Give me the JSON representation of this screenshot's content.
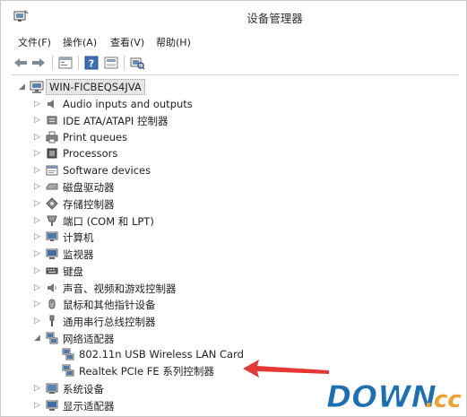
{
  "window": {
    "title": "设备管理器"
  },
  "menubar": {
    "items": [
      "文件(F)",
      "操作(A)",
      "查看(V)",
      "帮助(H)"
    ]
  },
  "toolbar": {
    "buttons": [
      "back-icon",
      "forward-icon",
      "properties-icon",
      "help-icon",
      "view-icon",
      "scan-hardware-icon"
    ]
  },
  "tree": {
    "root": "WIN-FICBEQS4JVA",
    "categories": [
      {
        "label": "Audio inputs and outputs",
        "icon": "speaker-icon",
        "expanded": false
      },
      {
        "label": "IDE ATA/ATAPI 控制器",
        "icon": "ide-controller-icon",
        "expanded": false
      },
      {
        "label": "Print queues",
        "icon": "printer-icon",
        "expanded": false
      },
      {
        "label": "Processors",
        "icon": "processor-icon",
        "expanded": false
      },
      {
        "label": "Software devices",
        "icon": "software-device-icon",
        "expanded": false
      },
      {
        "label": "磁盘驱动器",
        "icon": "disk-drive-icon",
        "expanded": false
      },
      {
        "label": "存储控制器",
        "icon": "storage-controller-icon",
        "expanded": false
      },
      {
        "label": "端口 (COM 和 LPT)",
        "icon": "port-icon",
        "expanded": false
      },
      {
        "label": "计算机",
        "icon": "computer-icon",
        "expanded": false
      },
      {
        "label": "监视器",
        "icon": "monitor-icon",
        "expanded": false
      },
      {
        "label": "键盘",
        "icon": "keyboard-icon",
        "expanded": false
      },
      {
        "label": "声音、视频和游戏控制器",
        "icon": "sound-icon",
        "expanded": false
      },
      {
        "label": "鼠标和其他指针设备",
        "icon": "mouse-icon",
        "expanded": false
      },
      {
        "label": "通用串行总线控制器",
        "icon": "usb-icon",
        "expanded": false
      },
      {
        "label": "网络适配器",
        "icon": "network-adapter-icon",
        "expanded": true
      },
      {
        "label": "系统设备",
        "icon": "system-device-icon",
        "expanded": false
      },
      {
        "label": "显示适配器",
        "icon": "display-adapter-icon",
        "expanded": false
      }
    ],
    "network_children": [
      "802.11n USB Wireless LAN Card",
      "Realtek PCIe FE 系列控制器"
    ]
  },
  "watermark": {
    "text_main": "DOWN",
    "text_suffix": ".cc",
    "main_color": "#1a6fb5",
    "suffix_color": "#f0a030"
  },
  "annotation": {
    "arrow_color": "#e53935"
  }
}
